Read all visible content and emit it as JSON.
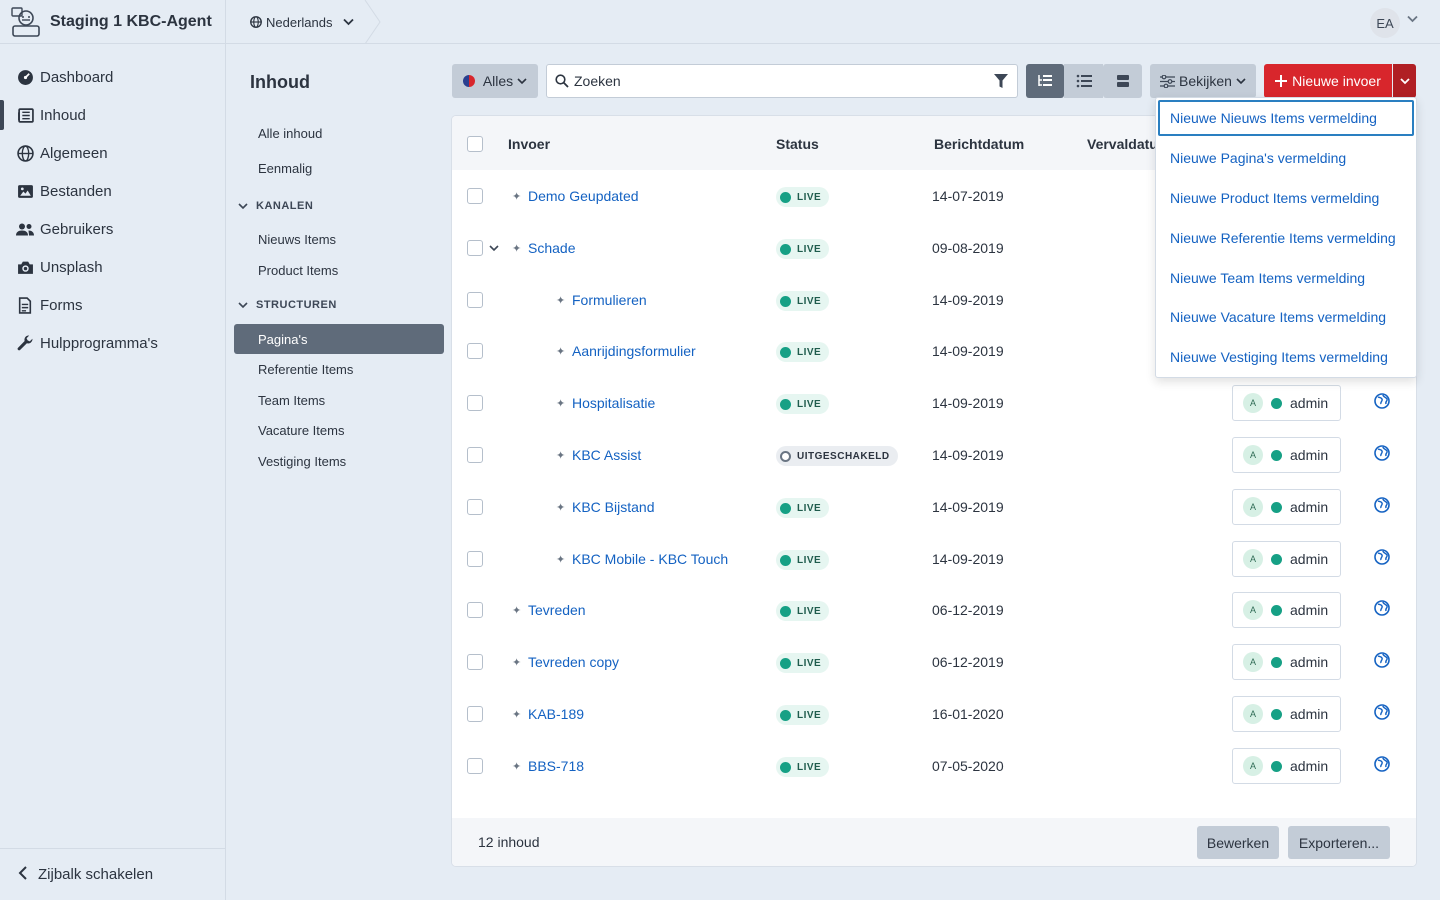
{
  "app": {
    "title": "Staging 1 KBC-Agent"
  },
  "sidebar": {
    "items": [
      {
        "label": "Dashboard",
        "icon": "dashboard-icon"
      },
      {
        "label": "Inhoud",
        "icon": "newspaper-icon",
        "active": true
      },
      {
        "label": "Algemeen",
        "icon": "globe-icon"
      },
      {
        "label": "Bestanden",
        "icon": "image-icon"
      },
      {
        "label": "Gebruikers",
        "icon": "users-icon"
      },
      {
        "label": "Unsplash",
        "icon": "camera-icon"
      },
      {
        "label": "Forms",
        "icon": "file-icon"
      },
      {
        "label": "Hulpprogramma's",
        "icon": "wrench-icon"
      }
    ],
    "toggle_label": "Zijbalk schakelen"
  },
  "topbar": {
    "language": "Nederlands",
    "user_initials": "EA"
  },
  "subnav": {
    "title": "Inhoud",
    "all": "Alle inhoud",
    "once": "Eenmalig",
    "channels_heading": "KANALEN",
    "channels": [
      "Nieuws Items",
      "Product Items"
    ],
    "structures_heading": "STRUCTUREN",
    "structures": [
      "Pagina's",
      "Referentie Items",
      "Team Items",
      "Vacature Items",
      "Vestiging Items"
    ]
  },
  "toolbar": {
    "site_filter": "Alles",
    "search_placeholder": "Zoeken",
    "view_label": "Bekijken",
    "new_entry_label": "Nieuwe invoer"
  },
  "table": {
    "headers": {
      "entry": "Invoer",
      "status": "Status",
      "post_date": "Berichtdatum",
      "expiry_date": "Vervaldatum"
    },
    "rows": [
      {
        "title": "Demo Geupdated",
        "status": "LIVE",
        "date": "14-07-2019",
        "level": 0,
        "owner": "admin",
        "initial": "A"
      },
      {
        "title": "Schade",
        "status": "LIVE",
        "date": "09-08-2019",
        "level": 0,
        "expanded": true,
        "owner": "admin",
        "initial": "A"
      },
      {
        "title": "Formulieren",
        "status": "LIVE",
        "date": "14-09-2019",
        "level": 1,
        "owner": "admin",
        "initial": "A"
      },
      {
        "title": "Aanrijdingsformulier",
        "status": "LIVE",
        "date": "14-09-2019",
        "level": 1,
        "owner": "admin",
        "initial": "A"
      },
      {
        "title": "Hospitalisatie",
        "status": "LIVE",
        "date": "14-09-2019",
        "level": 1,
        "owner": "admin",
        "initial": "A"
      },
      {
        "title": "KBC Assist",
        "status": "UITGESCHAKELD",
        "date": "14-09-2019",
        "level": 1,
        "owner": "admin",
        "initial": "A"
      },
      {
        "title": "KBC Bijstand",
        "status": "LIVE",
        "date": "14-09-2019",
        "level": 1,
        "owner": "admin",
        "initial": "A"
      },
      {
        "title": "KBC Mobile - KBC Touch",
        "status": "LIVE",
        "date": "14-09-2019",
        "level": 1,
        "owner": "admin",
        "initial": "A"
      },
      {
        "title": "Tevreden",
        "status": "LIVE",
        "date": "06-12-2019",
        "level": 0,
        "owner": "admin",
        "initial": "A"
      },
      {
        "title": "Tevreden copy",
        "status": "LIVE",
        "date": "06-12-2019",
        "level": 0,
        "owner": "admin",
        "initial": "A"
      },
      {
        "title": "KAB-189",
        "status": "LIVE",
        "date": "16-01-2020",
        "level": 0,
        "owner": "admin",
        "initial": "A"
      },
      {
        "title": "BBS-718",
        "status": "LIVE",
        "date": "07-05-2020",
        "level": 0,
        "owner": "admin",
        "initial": "A"
      }
    ],
    "footer_count": "12 inhoud",
    "edit_label": "Bewerken",
    "export_label": "Exporteren..."
  },
  "dropdown": {
    "items": [
      "Nieuwe Nieuws Items vermelding",
      "Nieuwe Pagina's vermelding",
      "Nieuwe Product Items vermelding",
      "Nieuwe Referentie Items vermelding",
      "Nieuwe Team Items vermelding",
      "Nieuwe Vacature Items vermelding",
      "Nieuwe Vestiging Items vermelding"
    ]
  },
  "colors": {
    "accent_red": "#d8262c",
    "link_blue": "#1462c2",
    "live_green": "#16a085",
    "sidebar_bg": "#e5ecf4"
  }
}
